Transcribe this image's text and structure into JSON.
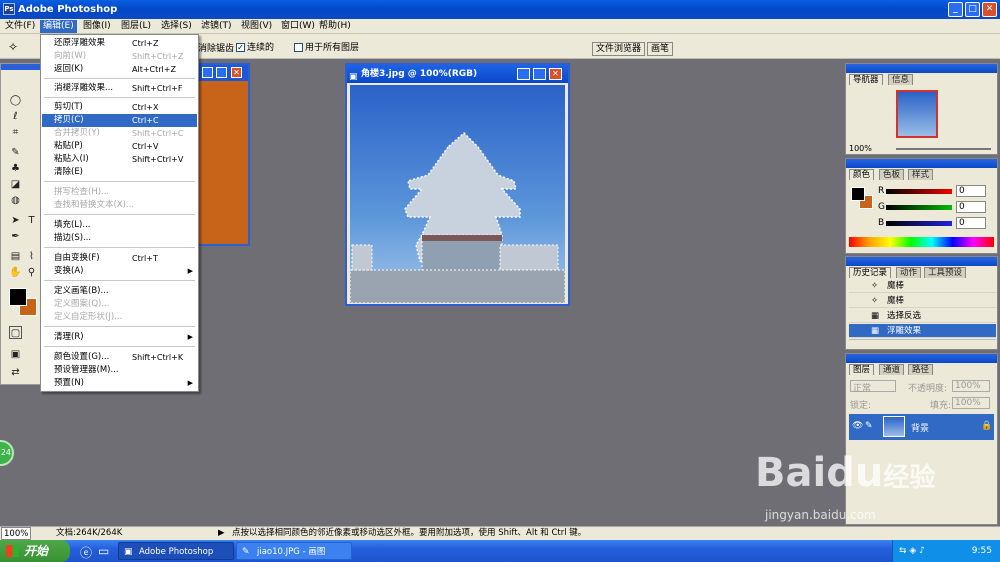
{
  "app": {
    "title": "Adobe Photoshop",
    "min_glyph": "_",
    "max_glyph": "□",
    "close_glyph": "✕"
  },
  "menubar": [
    "文件(F)",
    "编辑(E)",
    "图像(I)",
    "图层(L)",
    "选择(S)",
    "滤镜(T)",
    "视图(V)",
    "窗口(W)",
    "帮助(H)"
  ],
  "options": {
    "label_fragment": "消除锯齿",
    "contiguous_label": "连续的",
    "contiguous_checked": true,
    "all_layers_label": "用于所有图层",
    "all_layers_checked": false,
    "file_browser": "文件浏览器",
    "brushes": "画笔"
  },
  "edit_menu": {
    "items": [
      {
        "label": "还原浮雕效果",
        "shortcut": "Ctrl+Z",
        "disabled": false
      },
      {
        "label": "向前(W)",
        "shortcut": "Shift+Ctrl+Z",
        "disabled": true
      },
      {
        "label": "返回(K)",
        "shortcut": "Alt+Ctrl+Z",
        "disabled": false
      },
      {
        "label": "消褪浮雕效果...",
        "shortcut": "Shift+Ctrl+F",
        "disabled": false
      },
      {
        "label": "剪切(T)",
        "shortcut": "Ctrl+X",
        "disabled": false
      },
      {
        "label": "拷贝(C)",
        "shortcut": "Ctrl+C",
        "disabled": false,
        "highlighted": true
      },
      {
        "label": "合并拷贝(Y)",
        "shortcut": "Shift+Ctrl+C",
        "disabled": true
      },
      {
        "label": "粘贴(P)",
        "shortcut": "Ctrl+V",
        "disabled": false
      },
      {
        "label": "粘贴入(I)",
        "shortcut": "Shift+Ctrl+V",
        "disabled": false
      },
      {
        "label": "清除(E)",
        "shortcut": "",
        "disabled": false
      },
      {
        "label": "拼写检查(H)...",
        "shortcut": "",
        "disabled": true
      },
      {
        "label": "查找和替换文本(X)...",
        "shortcut": "",
        "disabled": true
      },
      {
        "label": "填充(L)...",
        "shortcut": "",
        "disabled": false
      },
      {
        "label": "描边(S)...",
        "shortcut": "",
        "disabled": false
      },
      {
        "label": "自由变换(F)",
        "shortcut": "Ctrl+T",
        "disabled": false
      },
      {
        "label": "变换(A)",
        "shortcut": "",
        "disabled": false,
        "submenu": true
      },
      {
        "label": "定义画笔(B)...",
        "shortcut": "",
        "disabled": false
      },
      {
        "label": "定义图案(Q)...",
        "shortcut": "",
        "disabled": true
      },
      {
        "label": "定义自定形状(J)...",
        "shortcut": "",
        "disabled": true
      },
      {
        "label": "清理(R)",
        "shortcut": "",
        "disabled": false,
        "submenu": true
      },
      {
        "label": "颜色设置(G)...",
        "shortcut": "Shift+Ctrl+K",
        "disabled": false
      },
      {
        "label": "预设管理器(M)...",
        "shortcut": "",
        "disabled": false
      },
      {
        "label": "预置(N)",
        "shortcut": "",
        "disabled": false,
        "submenu": true
      }
    ],
    "submenu_glyph": "▶"
  },
  "document": {
    "title": "角楼3.jpg @ 100%(RGB)"
  },
  "navigator": {
    "tabs": [
      "导航器",
      "信息"
    ],
    "zoom": "100%"
  },
  "color_panel": {
    "tabs": [
      "颜色",
      "色板",
      "样式"
    ],
    "r_label": "R",
    "r_value": "0",
    "g_label": "G",
    "g_value": "0",
    "b_label": "B",
    "b_value": "0"
  },
  "history": {
    "tabs": [
      "历史记录",
      "动作",
      "工具预设"
    ],
    "items": [
      "魔棒",
      "魔棒",
      "选择反选",
      "浮雕效果"
    ]
  },
  "layers": {
    "tabs": [
      "图层",
      "通道",
      "路径"
    ],
    "mode": "正常",
    "opacity_label": "不透明度:",
    "opacity_value": "100%",
    "lock_label": "锁定:",
    "fill_label": "填充:",
    "fill_value": "100%",
    "layer_name": "背景"
  },
  "status": {
    "zoom": "100%",
    "doc_info": "文档:264K/264K",
    "hint": "点按以选择相同颜色的邻近像素或移动选区外框。要用附加选项，使用 Shift、Alt 和 Ctrl 键。"
  },
  "taskbar": {
    "start": "开始",
    "tasks": [
      "Adobe Photoshop",
      "jiao10.JPG - 画图"
    ],
    "clock": "9:55",
    "badge": "24"
  },
  "watermark": {
    "brand": "Baidu",
    "cn": "经验",
    "url": "jingyan.baidu.com"
  },
  "colors": {
    "highlight": "#316ac5",
    "foreground_swatch": "#000000",
    "background_swatch": "#c8641a"
  }
}
